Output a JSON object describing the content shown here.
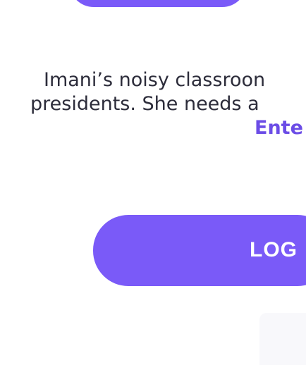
{
  "story": {
    "line1": "Imani’s noisy classroon",
    "line2": "presidents. She needs a",
    "line3": "Ente"
  },
  "login": {
    "label": "LOG"
  },
  "colors": {
    "accent": "#7a5af8",
    "accent_text": "#6b4ce6",
    "body_text": "#2c2c3a"
  }
}
